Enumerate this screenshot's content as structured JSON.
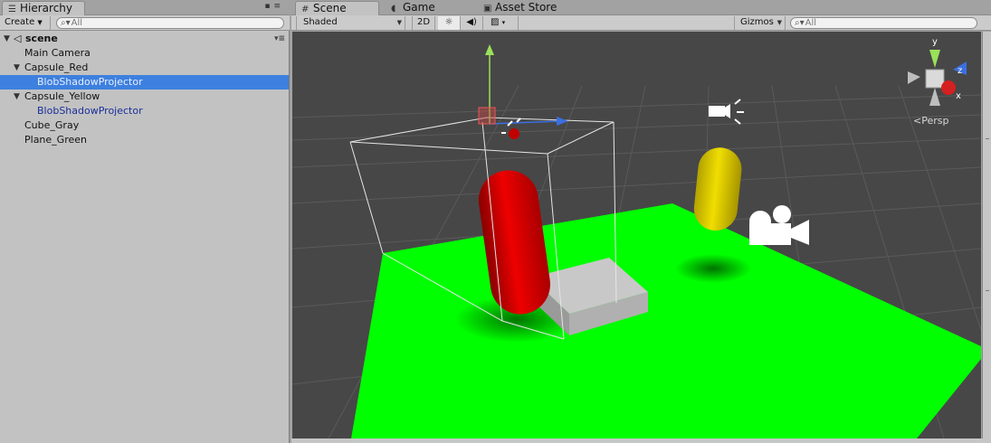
{
  "hierarchy": {
    "tab_label": "Hierarchy",
    "create_label": "Create",
    "search_placeholder": "All",
    "scene_name": "scene",
    "items": [
      {
        "label": "Main Camera",
        "depth": 1
      },
      {
        "label": "Capsule_Red",
        "depth": 1
      },
      {
        "label": "BlobShadowProjector",
        "depth": 2
      },
      {
        "label": "Capsule_Yellow",
        "depth": 1
      },
      {
        "label": "BlobShadowProjector",
        "depth": 2
      },
      {
        "label": "Cube_Gray",
        "depth": 1
      },
      {
        "label": "Plane_Green",
        "depth": 1
      }
    ]
  },
  "tabs": {
    "scene": "Scene",
    "game": "Game",
    "asset_store": "Asset Store"
  },
  "scene_toolbar": {
    "shading_mode": "Shaded",
    "two_d": "2D",
    "gizmos": "Gizmos",
    "search_placeholder": "All"
  },
  "viewport": {
    "projection": "Persp",
    "gizmo_y": "y",
    "gizmo_z": "z",
    "gizmo_x": "x",
    "colors": {
      "background": "#474747",
      "plane": "#00ff00",
      "capsule_red": "#dd0000",
      "capsule_yellow": "#e4d000",
      "cube": "#b5b5b5",
      "selection": "#3d80df"
    }
  }
}
